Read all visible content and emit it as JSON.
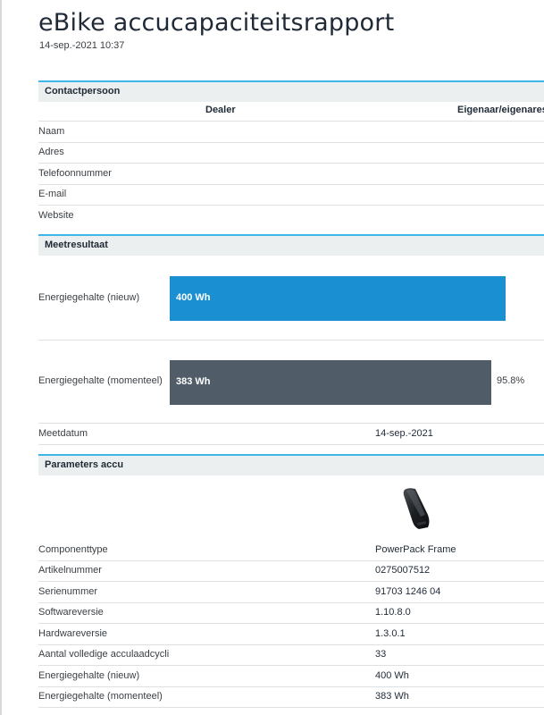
{
  "header": {
    "title": "eBike accucapaciteitsrapport",
    "datetime": "14-sep.-2021 10:37"
  },
  "contact": {
    "section_title": "Contactpersoon",
    "col_dealer": "Dealer",
    "col_owner": "Eigenaar/eigenares",
    "rows": [
      "Naam",
      "Adres",
      "Telefoonnummer",
      "E-mail",
      "Website"
    ]
  },
  "measurement": {
    "section_title": "Meetresultaat",
    "new_label": "Energiegehalte (nieuw)",
    "new_value": "400 Wh",
    "new_fraction": 1.0,
    "current_label": "Energiegehalte (momenteel)",
    "current_value": "383 Wh",
    "current_fraction": 0.958,
    "current_percent": "95.8%",
    "date_label": "Meetdatum",
    "date_value": "14-sep.-2021",
    "colors": {
      "new_bar": "#1a8fd1",
      "current_bar": "#505c68"
    }
  },
  "parameters": {
    "section_title": "Parameters accu",
    "image_icon": "battery-pack-icon",
    "rows": [
      {
        "label": "Componenttype",
        "value": "PowerPack Frame"
      },
      {
        "label": "Artikelnummer",
        "value": "0275007512"
      },
      {
        "label": "Serienummer",
        "value": "91703 1246 04"
      },
      {
        "label": "Softwareversie",
        "value": "1.10.8.0"
      },
      {
        "label": "Hardwareversie",
        "value": "1.3.0.1"
      },
      {
        "label": "Aantal volledige acculaadcycli",
        "value": "33"
      },
      {
        "label": "Energiegehalte (nieuw)",
        "value": "400 Wh"
      },
      {
        "label": "Energiegehalte (momenteel)",
        "value": "383 Wh"
      }
    ]
  }
}
